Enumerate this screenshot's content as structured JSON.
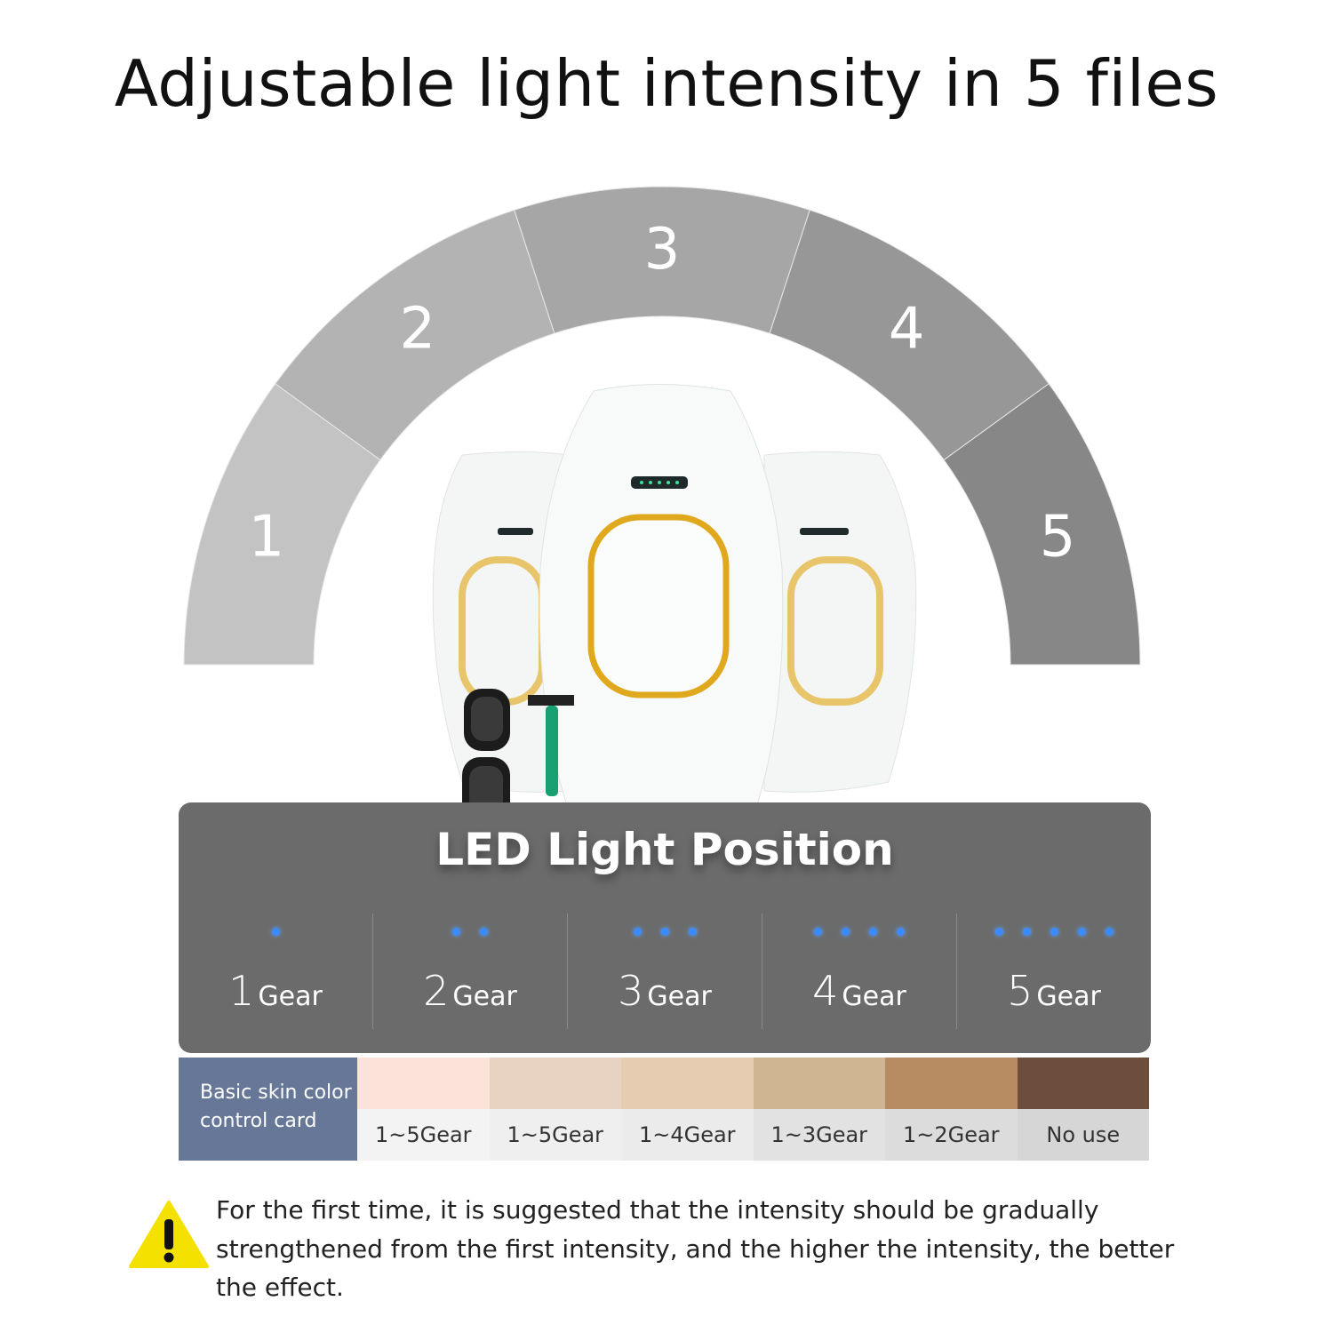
{
  "title": "Adjustable light intensity in 5 files",
  "arc": {
    "labels": [
      "1",
      "2",
      "3",
      "4",
      "5"
    ],
    "colors": [
      "#c3c3c3",
      "#b3b3b3",
      "#a6a6a6",
      "#979797",
      "#878787"
    ]
  },
  "panel": {
    "title": "LED Light Position",
    "gears": [
      {
        "number": "1",
        "label": "Gear",
        "dots": 1
      },
      {
        "number": "2",
        "label": "Gear",
        "dots": 2
      },
      {
        "number": "3",
        "label": "Gear",
        "dots": 3
      },
      {
        "number": "4",
        "label": "Gear",
        "dots": 4
      },
      {
        "number": "5",
        "label": "Gear",
        "dots": 5
      }
    ]
  },
  "skin_card": {
    "label": "Basic skin color control card",
    "swatches": [
      {
        "color": "#fbe3da",
        "label": "1~5Gear"
      },
      {
        "color": "#e8d3c3",
        "label": "1~5Gear"
      },
      {
        "color": "#e6cdb2",
        "label": "1~4Gear"
      },
      {
        "color": "#d0b591",
        "label": "1~3Gear"
      },
      {
        "color": "#b88c62",
        "label": "1~2Gear"
      },
      {
        "color": "#6d4d3b",
        "label": "No use"
      }
    ]
  },
  "note": "For the first time, it is suggested that the intensity should be gradually strengthened from the first intensity, and the higher the intensity, the better the effect.",
  "colors": {
    "panel": "#6b6b6b",
    "card": "#667797",
    "led": "#3a8bff",
    "warning": "#f5e100",
    "gold": "#e0a81c"
  }
}
